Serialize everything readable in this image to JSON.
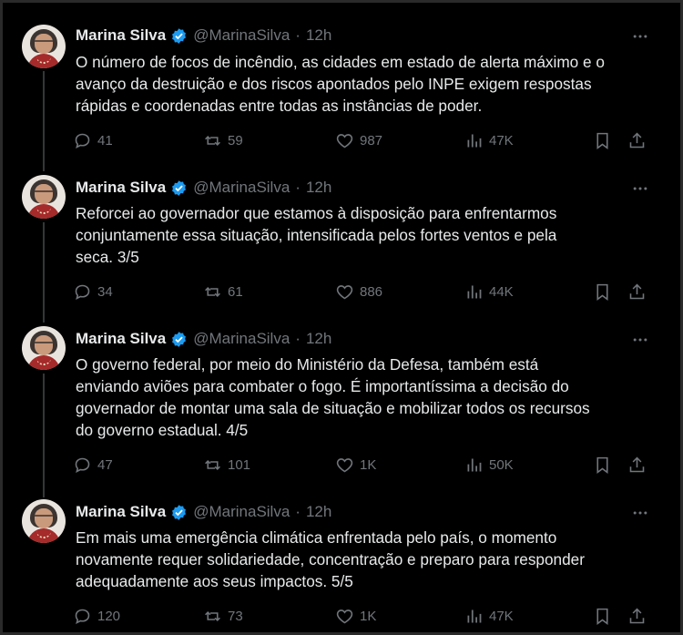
{
  "author": {
    "name": "Marina Silva",
    "handle": "@MarinaSilva",
    "separator": "·",
    "time": "12h",
    "verified_color": "#1d9bf0"
  },
  "icons": {
    "reply": "reply-icon",
    "retweet": "retweet-icon",
    "like": "heart-icon",
    "views": "views-icon",
    "bookmark": "bookmark-icon",
    "share": "share-icon",
    "more": "more-icon"
  },
  "tweets": [
    {
      "lines": [
        "O número de focos de incêndio, as cidades em estado de alerta máximo e o",
        "avanço da destruição e dos riscos apontados pelo INPE exigem respostas",
        "rápidas e coordenadas entre todas as instâncias de poder."
      ],
      "replies": "41",
      "retweets": "59",
      "likes": "987",
      "views": "47K"
    },
    {
      "lines": [
        "Reforcei ao governador que estamos à disposição para enfrentarmos",
        "conjuntamente essa situação, intensificada pelos fortes ventos e pela",
        "seca. 3/5"
      ],
      "replies": "34",
      "retweets": "61",
      "likes": "886",
      "views": "44K"
    },
    {
      "lines": [
        "O governo federal, por meio do Ministério da Defesa, também está",
        "enviando aviões para combater o fogo. É importantíssima a decisão do",
        "governador de montar uma sala de situação e mobilizar todos os recursos",
        "do governo estadual.  4/5"
      ],
      "replies": "47",
      "retweets": "101",
      "likes": "1K",
      "views": "50K"
    },
    {
      "lines": [
        "Em mais uma emergência climática enfrentada pelo país, o momento",
        "novamente requer solidariedade, concentração e preparo para responder",
        "adequadamente aos seus impactos. 5/5"
      ],
      "replies": "120",
      "retweets": "73",
      "likes": "1K",
      "views": "47K"
    }
  ]
}
